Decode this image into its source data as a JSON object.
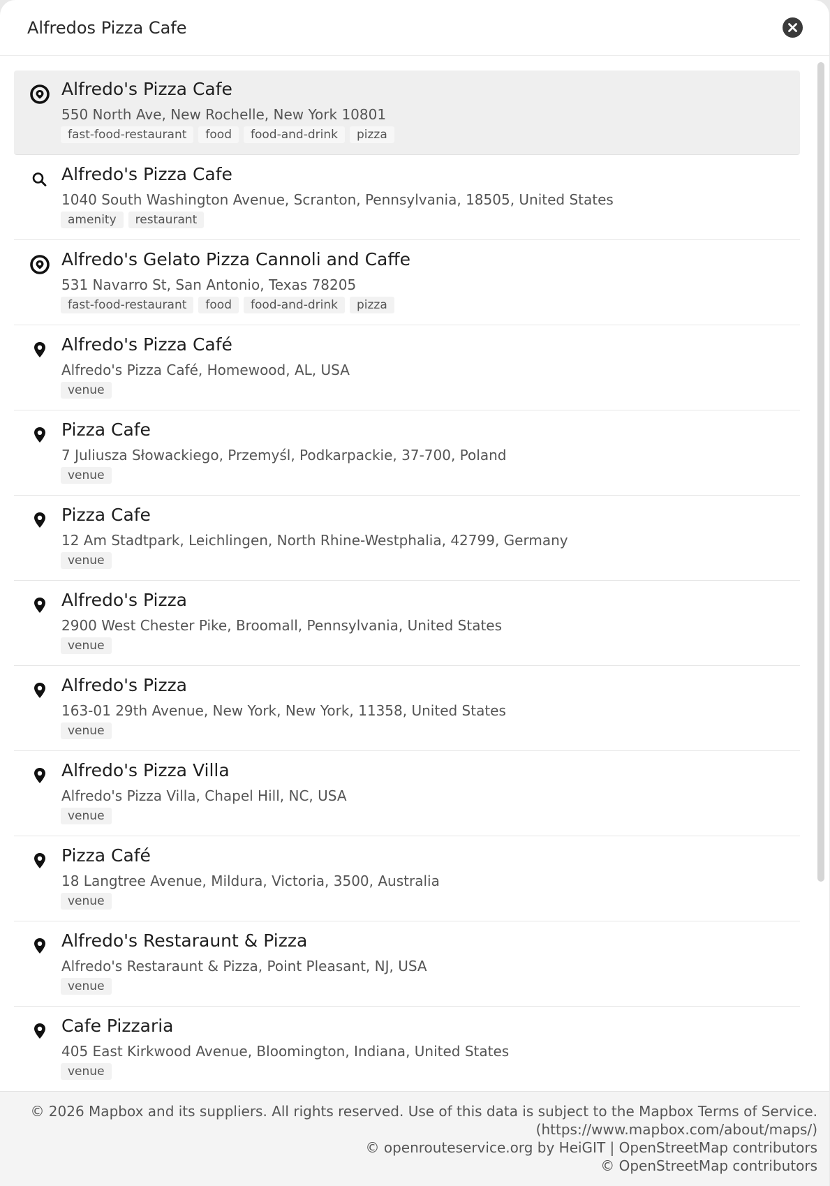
{
  "search": {
    "value": "Alfredos Pizza Cafe",
    "clear_label": "Clear search"
  },
  "results": [
    {
      "icon": "poi-icon",
      "name": "Alfredo's Pizza Cafe",
      "address": "550 North Ave, New Rochelle, New York 10801",
      "tags": [
        "fast-food-restaurant",
        "food",
        "food-and-drink",
        "pizza"
      ],
      "selected": true
    },
    {
      "icon": "search-icon",
      "name": "Alfredo's Pizza Cafe",
      "address": "1040 South Washington Avenue, Scranton, Pennsylvania, 18505, United States",
      "tags": [
        "amenity",
        "restaurant"
      ]
    },
    {
      "icon": "poi-icon",
      "name": "Alfredo's Gelato Pizza Cannoli and Caffe",
      "address": "531 Navarro St, San Antonio, Texas 78205",
      "tags": [
        "fast-food-restaurant",
        "food",
        "food-and-drink",
        "pizza"
      ]
    },
    {
      "icon": "map-pin-icon",
      "name": "Alfredo's Pizza Café",
      "address": "Alfredo's Pizza Café, Homewood, AL, USA",
      "tags": [
        "venue"
      ]
    },
    {
      "icon": "map-pin-icon",
      "name": "Pizza Cafe",
      "address": "7 Juliusza Słowackiego, Przemyśl, Podkarpackie, 37-700, Poland",
      "tags": [
        "venue"
      ]
    },
    {
      "icon": "map-pin-icon",
      "name": "Pizza Cafe",
      "address": "12 Am Stadtpark, Leichlingen, North Rhine-Westphalia, 42799, Germany",
      "tags": [
        "venue"
      ]
    },
    {
      "icon": "map-pin-icon",
      "name": "Alfredo's Pizza",
      "address": "2900 West Chester Pike, Broomall, Pennsylvania, United States",
      "tags": [
        "venue"
      ]
    },
    {
      "icon": "map-pin-icon",
      "name": "Alfredo's Pizza",
      "address": "163-01 29th Avenue, New York, New York, 11358, United States",
      "tags": [
        "venue"
      ]
    },
    {
      "icon": "map-pin-icon",
      "name": "Alfredo's Pizza Villa",
      "address": "Alfredo's Pizza Villa, Chapel Hill, NC, USA",
      "tags": [
        "venue"
      ]
    },
    {
      "icon": "map-pin-icon",
      "name": "Pizza Café",
      "address": "18 Langtree Avenue, Mildura, Victoria, 3500, Australia",
      "tags": [
        "venue"
      ]
    },
    {
      "icon": "map-pin-icon",
      "name": "Alfredo's Restaraunt & Pizza",
      "address": "Alfredo's Restaraunt & Pizza, Point Pleasant, NJ, USA",
      "tags": [
        "venue"
      ]
    },
    {
      "icon": "map-pin-icon",
      "name": "Cafe Pizzaria",
      "address": "405 East Kirkwood Avenue, Bloomington, Indiana, United States",
      "tags": [
        "venue"
      ]
    }
  ],
  "footer": {
    "line1": "© 2026 Mapbox and its suppliers. All rights reserved. Use of this data is subject to the Mapbox Terms of Service.",
    "line2": "(https://www.mapbox.com/about/maps/)",
    "line3": "© openrouteservice.org by HeiGIT | OpenStreetMap contributors",
    "line4": "© OpenStreetMap contributors"
  },
  "colors": {
    "selected_row": "#efefef",
    "tag_background": "#f2f2f2",
    "footer_background": "#f4f4f4",
    "icon": "#111111"
  }
}
